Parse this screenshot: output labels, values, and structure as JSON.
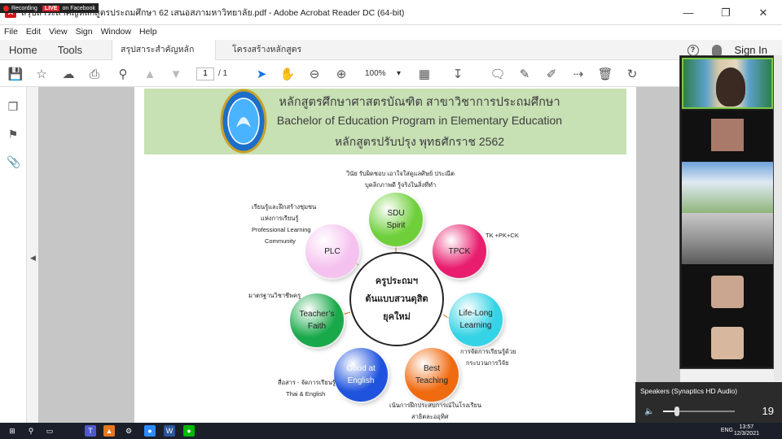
{
  "recording": {
    "label": "Recording",
    "live": "LIVE",
    "platform": "on Facebook"
  },
  "window": {
    "title": "สรุปสาระสำคัญหลักสูตรประถมศึกษา 62 เสนอสภามหาวิทยาลัย.pdf - Adobe Acrobat Reader DC (64-bit)"
  },
  "menu": [
    "File",
    "Edit",
    "View",
    "Sign",
    "Window",
    "Help"
  ],
  "tabs": {
    "home": "Home",
    "tools": "Tools",
    "doc1": "สรุปสาระสำคัญหลักสูต...",
    "doc2": "โครงสร้างหลักสูตรประ...",
    "sign_in": "Sign In"
  },
  "toolbar": {
    "page_current": "1",
    "page_total": "/ 1",
    "zoom": "100%"
  },
  "header": {
    "line1": "หลักสูตรศึกษาศาสตรบัณฑิต สาขาวิชาการประถมศึกษา",
    "line2": "Bachelor of Education Program in Elementary Education",
    "line3": "หลักสูตรปรับปรุง พุทธศักราช 2562"
  },
  "center": {
    "line1": "ครูประถมฯ",
    "line2": "ต้นแบบสวนดุสิต",
    "line3": "ยุคใหม่"
  },
  "circles": {
    "sdu": {
      "line1": "SDU",
      "line2": "Spirit",
      "color": "#6ecf3a"
    },
    "tpck": {
      "line1": "TPCK",
      "color": "#e81d6e"
    },
    "lifelong": {
      "line1": "Life-Long",
      "line2": "Learning",
      "color": "#34d3e5"
    },
    "best": {
      "line1": "Best",
      "line2": "Teaching",
      "color": "#f06a10"
    },
    "good": {
      "line1": "Good at",
      "line2": "English",
      "color": "#1f53dd"
    },
    "faith": {
      "line1": "Teacher’s",
      "line2": "Faith",
      "color": "#1aa94a"
    },
    "plc": {
      "line1": "PLC",
      "color": "#f5c2ef"
    }
  },
  "annotations": {
    "sdu1": "วินัย รับผิดชอบ เอาใจใส่ดูแลศิษย์ ประณีต",
    "sdu2": "บุคลิกภาพดี รู้จริงในสิ่งที่ทำ",
    "tpck": "TK +PK+CK",
    "life1": "การจัดการเรียนรู้ด้วย",
    "life2": "กระบวนการวิจัย",
    "best1": "เน้นการฝึกประสบการณ์ในโรงเรียน",
    "best2": "สาธิตละออุทิศ",
    "good1": "สื่อสาร - จัดการเรียนรู้",
    "good2": "Thai & English",
    "faith": "มาตรฐานวิชาชีพครู",
    "plc1": "เรียนรู้และฝึกสร้างชุมชน",
    "plc2": "แห่งการเรียนรู้",
    "plc3": "Professional Learning",
    "plc4": "Community"
  },
  "speaker": {
    "device": "Speakers (Synaptics HD Audio)",
    "volume": "19",
    "volume_level": 0.19
  },
  "taskbar": {
    "lang": "ENG",
    "time": "13:57",
    "date": "12/3/2021"
  }
}
